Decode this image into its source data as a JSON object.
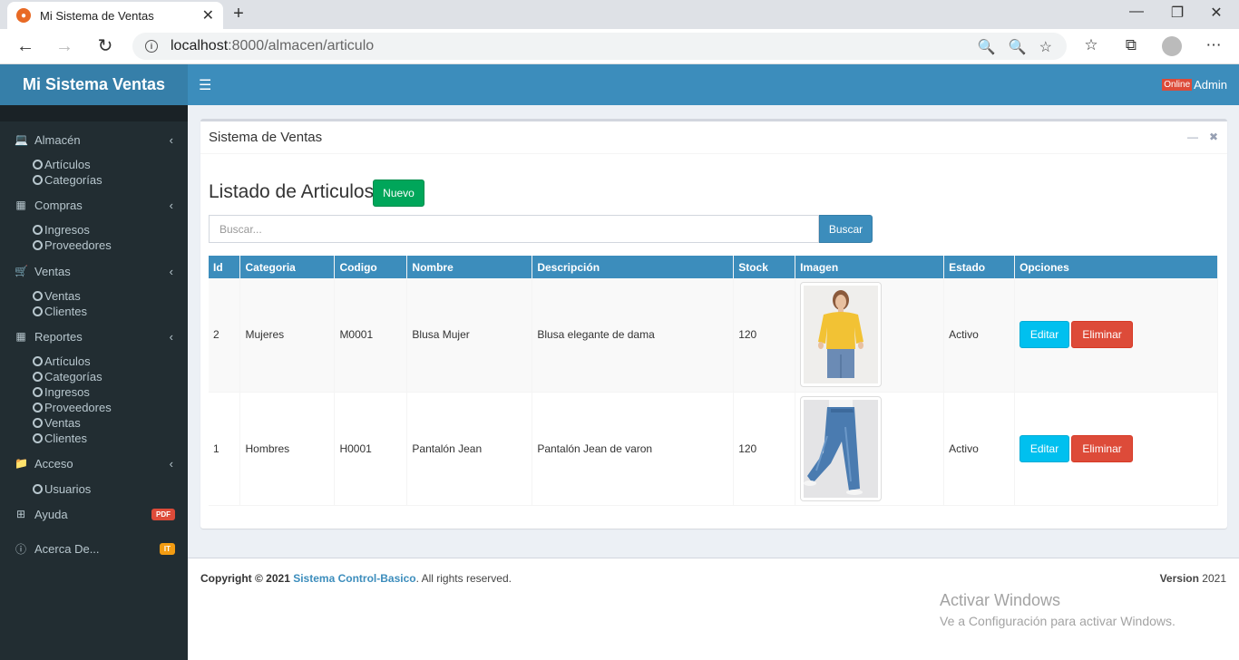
{
  "browser": {
    "tab_title": "Mi Sistema de Ventas",
    "tab_close": "✕",
    "new_tab": "+",
    "url_host": "localhost",
    "url_rest": ":8000/almacen/articulo"
  },
  "header": {
    "logo": "Mi Sistema Ventas",
    "online_badge": "Online",
    "user": "Admin"
  },
  "sidebar": {
    "almacen": {
      "label": "Almacén",
      "items": [
        "Artículos",
        "Categorías"
      ]
    },
    "compras": {
      "label": "Compras",
      "items": [
        "Ingresos",
        "Proveedores"
      ]
    },
    "ventas": {
      "label": "Ventas",
      "items": [
        "Ventas",
        "Clientes"
      ]
    },
    "reportes": {
      "label": "Reportes",
      "items": [
        "Artículos",
        "Categorías",
        "Ingresos",
        "Proveedores",
        "Ventas",
        "Clientes"
      ]
    },
    "acceso": {
      "label": "Acceso",
      "items": [
        "Usuarios"
      ]
    },
    "ayuda": {
      "label": "Ayuda",
      "badge": "PDF",
      "badge_color": "#dd4b39"
    },
    "acerca": {
      "label": "Acerca De...",
      "badge": "IT",
      "badge_color": "#f39c12"
    }
  },
  "box": {
    "title": "Sistema de Ventas",
    "list_title": "Listado de Articulos",
    "new_button": "Nuevo",
    "search_placeholder": "Buscar...",
    "search_button": "Buscar"
  },
  "table": {
    "headers": [
      "Id",
      "Categoria",
      "Codigo",
      "Nombre",
      "Descripción",
      "Stock",
      "Imagen",
      "Estado",
      "Opciones"
    ],
    "rows": [
      {
        "id": "2",
        "categoria": "Mujeres",
        "codigo": "M0001",
        "nombre": "Blusa Mujer",
        "descripcion": "Blusa elegante de dama",
        "stock": "120",
        "estado": "Activo"
      },
      {
        "id": "1",
        "categoria": "Hombres",
        "codigo": "H0001",
        "nombre": "Pantalón Jean",
        "descripcion": "Pantalón Jean de varon",
        "stock": "120",
        "estado": "Activo"
      }
    ],
    "edit_label": "Editar",
    "delete_label": "Eliminar"
  },
  "footer": {
    "copyright_prefix": "Copyright © 2021",
    "link": "Sistema Control-Basico",
    "suffix": ". All rights reserved.",
    "version_label": "Version",
    "version_value": "2021"
  },
  "watermark": {
    "line1": "Activar Windows",
    "line2": "Ve a Configuración para activar Windows."
  },
  "colors": {
    "primary": "#3c8dbc",
    "sidebar": "#222d32",
    "success": "#00a65a",
    "info": "#00c0ef",
    "danger": "#dd4b39"
  }
}
